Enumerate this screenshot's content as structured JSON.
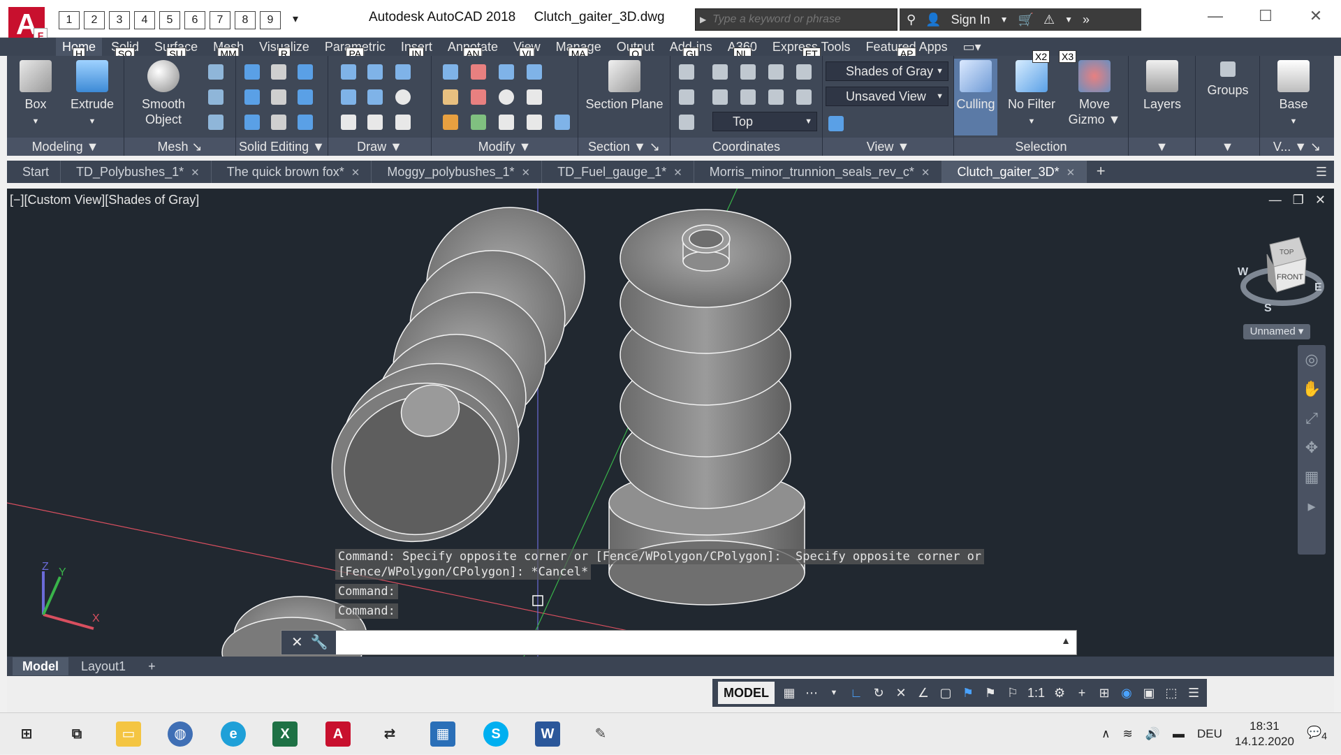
{
  "app": {
    "name": "Autodesk AutoCAD 2018",
    "file": "Clutch_gaiter_3D.dwg",
    "logo_letter": "A",
    "logo_key": "F"
  },
  "quick_access": [
    "1",
    "2",
    "3",
    "4",
    "5",
    "6",
    "7",
    "8",
    "9"
  ],
  "search": {
    "placeholder": "Type a keyword or phrase"
  },
  "title_tools": {
    "sign_in": "Sign In"
  },
  "window_controls": [
    "—",
    "☐",
    "✕"
  ],
  "ribbon_tabs": [
    {
      "label": "Home",
      "key": "H",
      "active": true
    },
    {
      "label": "Solid",
      "key": "SO"
    },
    {
      "label": "Surface",
      "key": "SU"
    },
    {
      "label": "Mesh",
      "key": "MM"
    },
    {
      "label": "Visualize",
      "key": "R"
    },
    {
      "label": "Parametric",
      "key": "PA"
    },
    {
      "label": "Insert",
      "key": "IN"
    },
    {
      "label": "Annotate",
      "key": "AN"
    },
    {
      "label": "View",
      "key": "VI"
    },
    {
      "label": "Manage",
      "key": "MA"
    },
    {
      "label": "Output",
      "key": "O"
    },
    {
      "label": "Add-ins",
      "key": "GI"
    },
    {
      "label": "A360",
      "key": "NL"
    },
    {
      "label": "Express Tools",
      "key": "ET"
    },
    {
      "label": "Featured Apps",
      "key": "AP"
    }
  ],
  "ribbon": {
    "modeling": {
      "label": "Modeling",
      "box": "Box",
      "extrude": "Extrude"
    },
    "mesh": {
      "label": "Mesh",
      "smooth": "Smooth\nObject"
    },
    "solid_editing": {
      "label": "Solid Editing"
    },
    "draw": {
      "label": "Draw"
    },
    "modify": {
      "label": "Modify"
    },
    "section": {
      "label": "Section",
      "section_plane": "Section Plane"
    },
    "coordinates": {
      "label": "Coordinates",
      "ucs": "Top"
    },
    "view": {
      "label": "View",
      "visual_style": "Shades of Gray",
      "named_view": "Unsaved View"
    },
    "selection": {
      "label": "Selection",
      "culling": "Culling",
      "no_filter": "No Filter",
      "gizmo": "Move Gizmo",
      "key_x2": "X2",
      "key_x3": "X3"
    },
    "layers": {
      "label": "Layers"
    },
    "groups": {
      "label": "Groups"
    },
    "base": {
      "label": "Base",
      "v": "V..."
    }
  },
  "file_tabs": [
    {
      "label": "Start"
    },
    {
      "label": "TD_Polybushes_1*"
    },
    {
      "label": "The quick brown fox*"
    },
    {
      "label": "Moggy_polybushes_1*"
    },
    {
      "label": "TD_Fuel_gauge_1*"
    },
    {
      "label": "Morris_minor_trunnion_seals_rev_c*"
    },
    {
      "label": "Clutch_gaiter_3D*",
      "active": true
    }
  ],
  "viewport": {
    "label": "[−][Custom View][Shades of Gray]",
    "viewcube": {
      "top": "TOP",
      "front": "FRONT",
      "w": "W",
      "e": "E",
      "s": "S",
      "named": "Unnamed"
    }
  },
  "command": {
    "history": [
      "Command: Specify opposite corner or [Fence/WPolygon/CPolygon]:  Specify opposite corner or",
      "[Fence/WPolygon/CPolygon]: *Cancel*",
      "Command:",
      "Command:"
    ],
    "input_value": ""
  },
  "layout_tabs": [
    {
      "label": "Model",
      "active": true
    },
    {
      "label": "Layout1"
    }
  ],
  "status": {
    "model": "MODEL",
    "scale": "1:1"
  },
  "taskbar": {
    "apps": [
      "Start",
      "Task View",
      "File Explorer",
      "Browser",
      "Edge",
      "Excel",
      "AutoCAD",
      "Tool",
      "Calculator",
      "Skype",
      "Word",
      "Paint"
    ],
    "lang": "DEU",
    "time": "18:31",
    "date": "14.12.2020",
    "notif": "4"
  },
  "colors": {
    "accent": "#4aa3ff",
    "ribbon": "#3f4857",
    "viewport": "#212830",
    "brand": "#c8102e"
  }
}
